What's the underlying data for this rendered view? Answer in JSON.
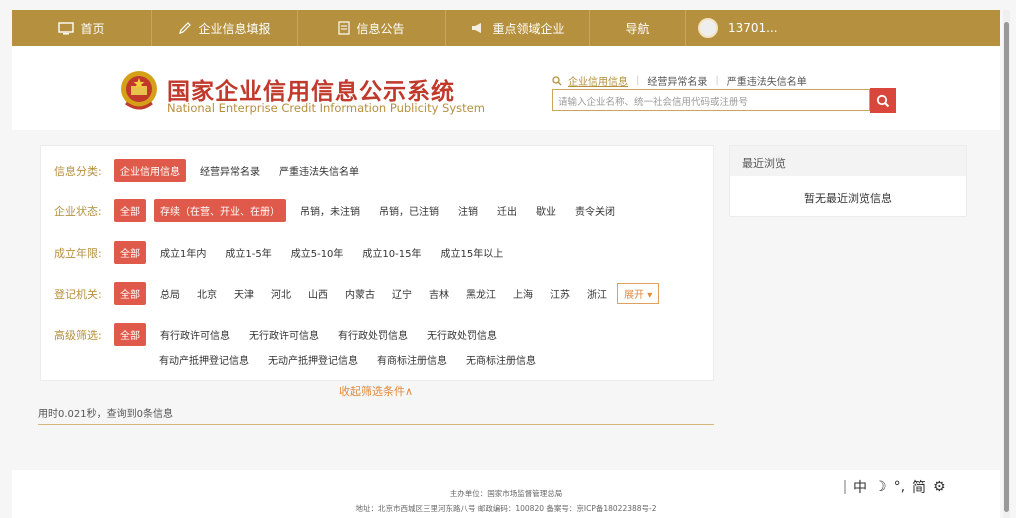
{
  "nav": {
    "items": [
      {
        "label": "首页",
        "icon": "monitor-icon"
      },
      {
        "label": "企业信息填报",
        "icon": "pencil-icon"
      },
      {
        "label": "信息公告",
        "icon": "document-icon"
      },
      {
        "label": "重点领域企业",
        "icon": "megaphone-icon"
      },
      {
        "label": "导航",
        "icon": ""
      }
    ],
    "user": "13701..."
  },
  "header": {
    "title": "国家企业信用信息公示系统",
    "subtitle": "National Enterprise Credit Information Publicity System"
  },
  "search": {
    "tabs": [
      "企业信用信息",
      "经营异常名录",
      "严重违法失信名单"
    ],
    "active_tab": 0,
    "placeholder": "请输入企业名称、统一社会信用代码或注册号"
  },
  "filters": {
    "category": {
      "label": "信息分类:",
      "options": [
        "企业信用信息",
        "经营异常名录",
        "严重违法失信名单"
      ]
    },
    "status": {
      "label": "企业状态:",
      "options": [
        "全部",
        "存续（在营、开业、在册）",
        "吊销，未注销",
        "吊销，已注销",
        "注销",
        "迁出",
        "歇业",
        "责令关闭"
      ]
    },
    "years": {
      "label": "成立年限:",
      "options": [
        "全部",
        "成立1年内",
        "成立1-5年",
        "成立5-10年",
        "成立10-15年",
        "成立15年以上"
      ]
    },
    "authority": {
      "label": "登记机关:",
      "options": [
        "全部",
        "总局",
        "北京",
        "天津",
        "河北",
        "山西",
        "内蒙古",
        "辽宁",
        "吉林",
        "黑龙江",
        "上海",
        "江苏",
        "浙江"
      ],
      "expand": "展开"
    },
    "advanced": {
      "label": "高级筛选:",
      "row1": [
        "全部",
        "有行政许可信息",
        "无行政许可信息",
        "有行政处罚信息",
        "无行政处罚信息"
      ],
      "row2": [
        "有动产抵押登记信息",
        "无动产抵押登记信息",
        "有商标注册信息",
        "无商标注册信息"
      ]
    }
  },
  "collapse_label": "收起筛选条件∧",
  "result_info": "用时0.021秒，查询到0条信息",
  "recent": {
    "title": "最近浏览",
    "empty": "暂无最近浏览信息"
  },
  "footer": {
    "sponsor": "主办单位：国家市场监督管理总局",
    "address": "地址：北京市西城区三里河东路八号   邮政编码：100820   备案号：京ICP备18022388号-2"
  },
  "ime": {
    "lang": "中",
    "mode": "☽",
    "punct": "°,",
    "script": "简",
    "settings": "⚙"
  },
  "colors": {
    "nav": "#b5903e",
    "accent": "#e05a4b",
    "title": "#c0392b",
    "label": "#b5903e"
  }
}
